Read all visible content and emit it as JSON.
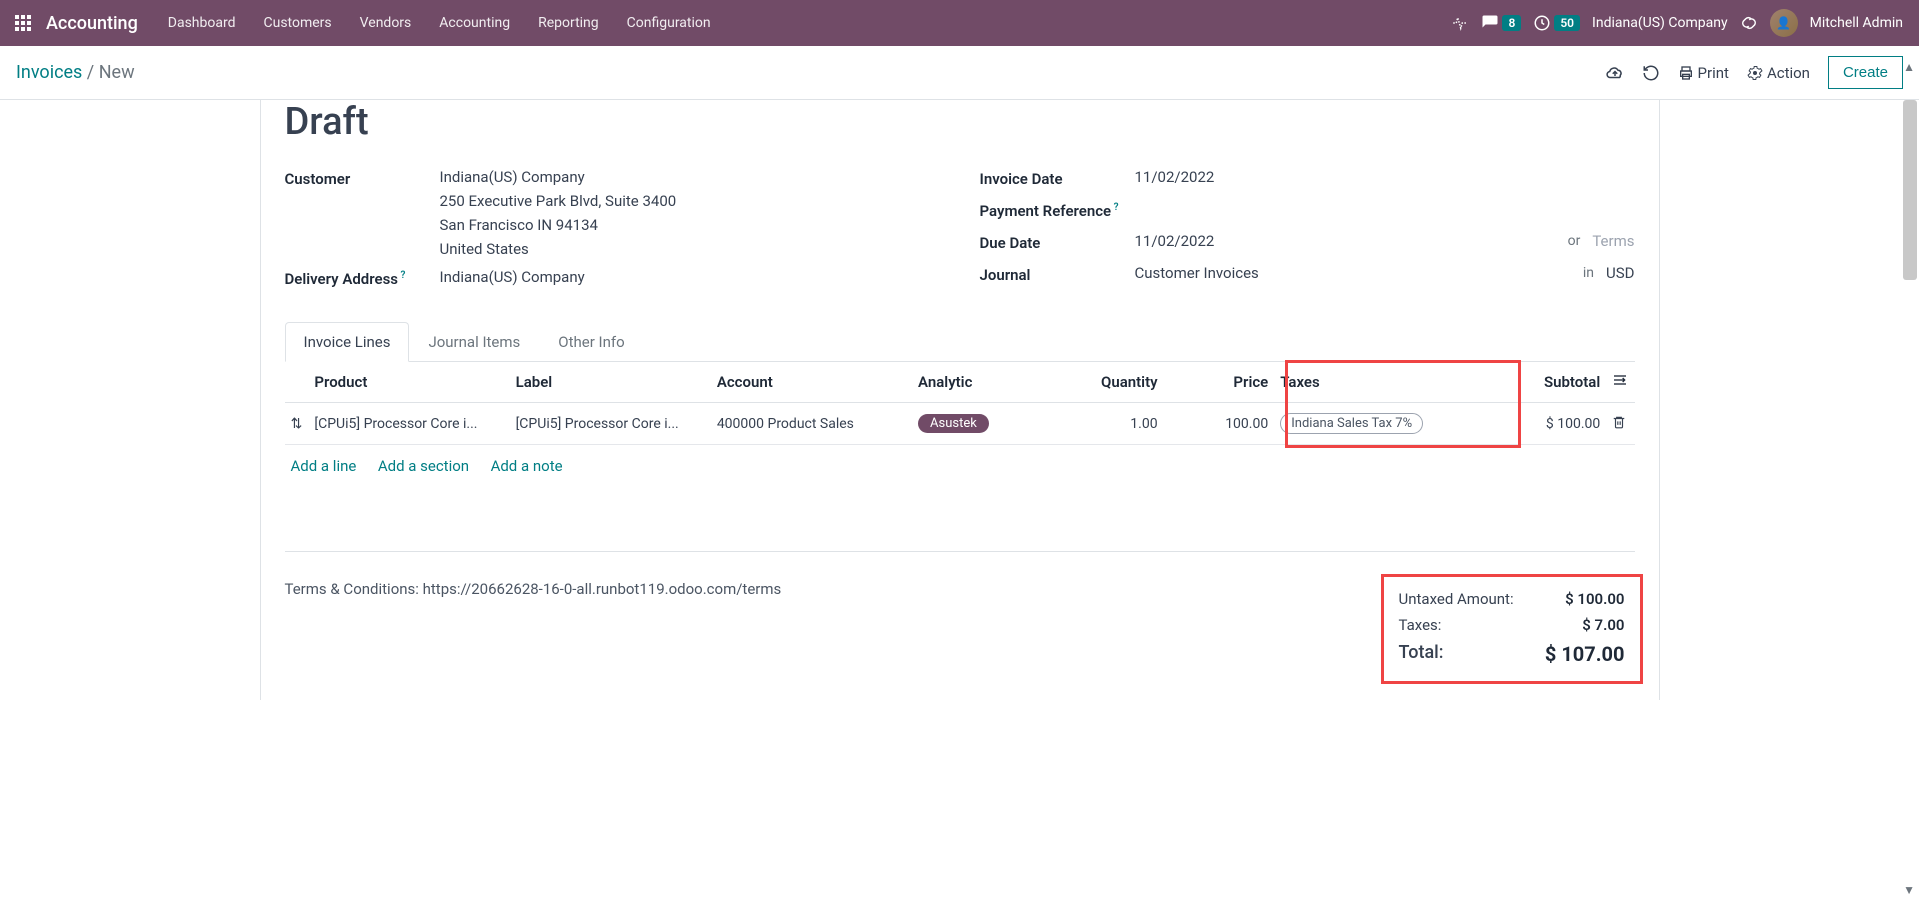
{
  "nav": {
    "app": "Accounting",
    "items": [
      "Dashboard",
      "Customers",
      "Vendors",
      "Accounting",
      "Reporting",
      "Configuration"
    ],
    "msg_badge": "8",
    "activity_badge": "50",
    "company": "Indiana(US) Company",
    "user": "Mitchell Admin"
  },
  "breadcrumb": {
    "root": "Invoices",
    "sep": " / ",
    "current": "New"
  },
  "actions": {
    "print": "Print",
    "action": "Action",
    "create": "Create"
  },
  "status": "Draft",
  "customer": {
    "label": "Customer",
    "name": "Indiana(US) Company",
    "addr1": "250 Executive Park Blvd, Suite 3400",
    "addr2": "San Francisco IN 94134",
    "country": "United States",
    "delivery_label": "Delivery Address",
    "delivery_value": "Indiana(US) Company"
  },
  "right_fields": {
    "invoice_date_label": "Invoice Date",
    "invoice_date": "11/02/2022",
    "payment_ref_label": "Payment Reference",
    "due_date_label": "Due Date",
    "due_date": "11/02/2022",
    "or": "or",
    "terms_ph": "Terms",
    "journal_label": "Journal",
    "journal": "Customer Invoices",
    "in": "in",
    "currency": "USD"
  },
  "tabs": [
    "Invoice Lines",
    "Journal Items",
    "Other Info"
  ],
  "columns": {
    "product": "Product",
    "label": "Label",
    "account": "Account",
    "analytic": "Analytic",
    "quantity": "Quantity",
    "price": "Price",
    "taxes": "Taxes",
    "subtotal": "Subtotal"
  },
  "line": {
    "product": "[CPUi5] Processor Core i...",
    "label": "[CPUi5] Processor Core i...",
    "account": "400000 Product Sales",
    "analytic": "Asustek",
    "quantity": "1.00",
    "price": "100.00",
    "tax": "Indiana Sales Tax 7%",
    "subtotal": "$ 100.00"
  },
  "add": {
    "line": "Add a line",
    "section": "Add a section",
    "note": "Add a note"
  },
  "terms": "Terms & Conditions: https://20662628-16-0-all.runbot119.odoo.com/terms",
  "totals": {
    "untaxed_label": "Untaxed Amount:",
    "untaxed": "$ 100.00",
    "taxes_label": "Taxes:",
    "taxes": "$ 7.00",
    "total_label": "Total:",
    "total": "$ 107.00"
  }
}
